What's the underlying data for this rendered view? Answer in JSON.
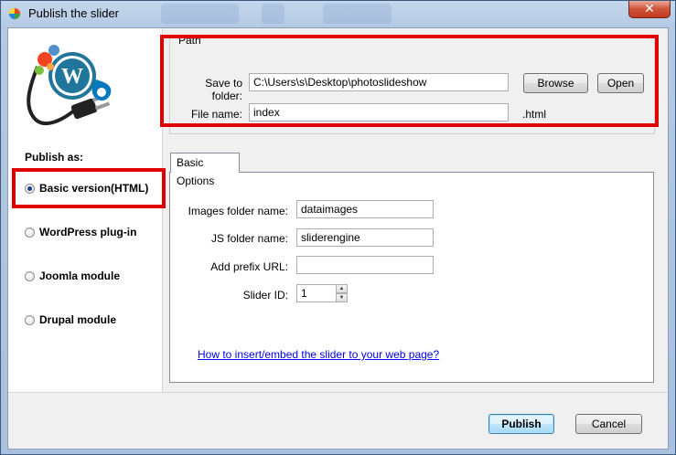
{
  "window": {
    "title": "Publish the slider",
    "close_label": "✕"
  },
  "sidebar": {
    "publish_as_label": "Publish as:",
    "options": [
      {
        "label": "Basic version(HTML)",
        "checked": true
      },
      {
        "label": "WordPress plug-in",
        "checked": false
      },
      {
        "label": "Joomla module",
        "checked": false
      },
      {
        "label": "Drupal module",
        "checked": false
      }
    ]
  },
  "path": {
    "group_label": "Path",
    "save_to_folder_label": "Save to folder:",
    "save_to_folder_value": "C:\\Users\\s\\Desktop\\photoslideshow",
    "browse_label": "Browse",
    "open_label": "Open",
    "file_name_label": "File name:",
    "file_name_value": "index",
    "extension": ".html"
  },
  "options": {
    "tab_label": "Basic Options",
    "images_folder_label": "Images folder name:",
    "images_folder_value": "dataimages",
    "js_folder_label": "JS folder name:",
    "js_folder_value": "sliderengine",
    "prefix_url_label": "Add prefix URL:",
    "prefix_url_value": "",
    "slider_id_label": "Slider ID:",
    "slider_id_value": "1",
    "help_link": "How to insert/embed the slider to your web page?"
  },
  "footer": {
    "publish_label": "Publish",
    "cancel_label": "Cancel"
  },
  "icons": {
    "logo": "cms-plug-logo-icon",
    "app": "app-icon"
  },
  "colors": {
    "highlight_red": "#e00000",
    "link": "#0000ee"
  }
}
